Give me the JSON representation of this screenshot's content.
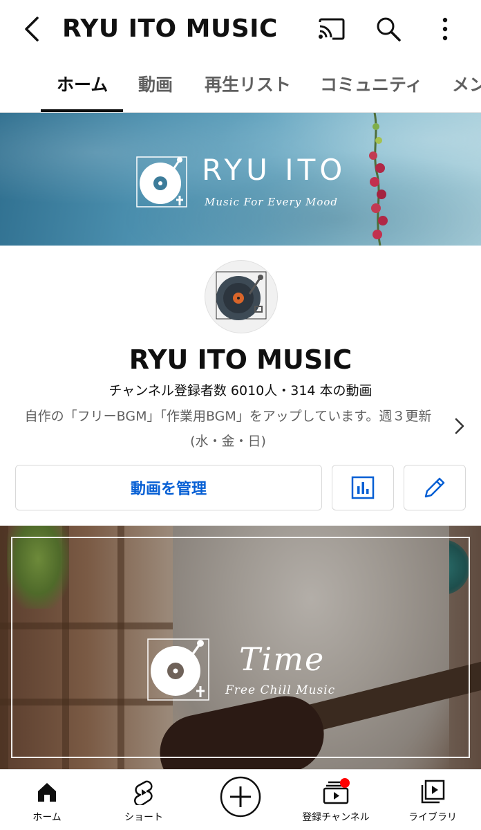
{
  "header": {
    "title": "RYU ITO MUSIC",
    "icons": [
      "back-icon",
      "cast-icon",
      "search-icon",
      "more-vert-icon"
    ]
  },
  "tabs": [
    {
      "label": "ホーム",
      "active": true
    },
    {
      "label": "動画",
      "active": false
    },
    {
      "label": "再生リスト",
      "active": false
    },
    {
      "label": "コミュニティ",
      "active": false
    },
    {
      "label": "メン",
      "active": false
    }
  ],
  "banner": {
    "title": "RYU ITO",
    "subtitle": "Music For Every Mood"
  },
  "channel": {
    "name": "RYU ITO MUSIC",
    "stats": "チャンネル登録者数 6010人・314 本の動画",
    "description": "自作の「フリーBGM」「作業用BGM」をアップしています。週３更新(水・金・日)"
  },
  "actions": {
    "manage_label": "動画を管理",
    "analytics_icon": "analytics-icon",
    "edit_icon": "edit-pencil-icon",
    "accent": "#065fd4"
  },
  "featured_video": {
    "title": "Time",
    "subtitle": "Free Chill Music"
  },
  "bottom_nav": [
    {
      "label": "ホーム",
      "icon": "home-icon"
    },
    {
      "label": "ショート",
      "icon": "shorts-icon"
    },
    {
      "label": "",
      "icon": "create-plus-icon"
    },
    {
      "label": "登録チャンネル",
      "icon": "subscriptions-icon",
      "badge": true
    },
    {
      "label": "ライブラリ",
      "icon": "library-icon"
    }
  ],
  "colors": {
    "badge": "#ff0000",
    "text_primary": "#0f0f0f",
    "text_secondary": "#606060"
  }
}
